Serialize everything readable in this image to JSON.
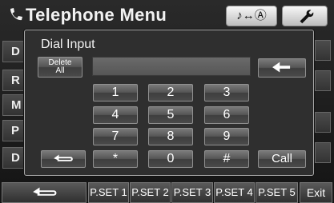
{
  "header": {
    "title": "Telephone Menu",
    "source_toggle_label": "♪↔Ⓐ"
  },
  "background_menu": {
    "items": [
      "D",
      "R",
      "M",
      "P",
      "D"
    ]
  },
  "dial_input": {
    "title": "Dial Input",
    "delete_all_line1": "Delete",
    "delete_all_line2": "All",
    "number_value": "",
    "keys": [
      "1",
      "2",
      "3",
      "4",
      "5",
      "6",
      "7",
      "8",
      "9",
      "*",
      "0",
      "#"
    ],
    "call_label": "Call"
  },
  "bottom_bar": {
    "presets": [
      "P.SET 1",
      "P.SET 2",
      "P.SET 3",
      "P.SET 4",
      "P.SET 5"
    ],
    "exit_label": "Exit"
  },
  "colors": {
    "panel": "#2f2f2f",
    "button_gradient_top": "#7a7a7a",
    "header_button": "#e6e6e6"
  }
}
